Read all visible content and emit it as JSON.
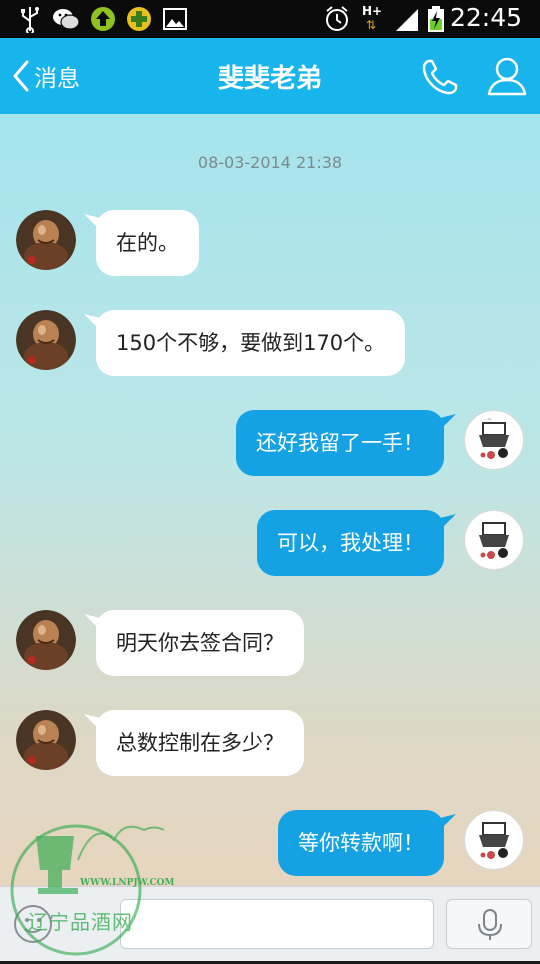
{
  "status_bar": {
    "time": "22:45",
    "network": "H+",
    "icons": [
      "usb-icon",
      "wechat-icon",
      "upload-icon",
      "plus-app-icon",
      "image-icon",
      "alarm-icon",
      "network-hplus-icon",
      "signal-icon",
      "battery-charging-icon"
    ]
  },
  "header": {
    "back_label": "消息",
    "title": "斐斐老弟",
    "accent": "#18b4ec"
  },
  "chat": {
    "timestamp": "08-03-2014 21:38",
    "messages": [
      {
        "side": "in",
        "text": "在的。"
      },
      {
        "side": "in",
        "text": "150个不够，要做到170个。"
      },
      {
        "side": "out",
        "text": "还好我留了一手！"
      },
      {
        "side": "out",
        "text": "可以，我处理！"
      },
      {
        "side": "in",
        "text": "明天你去签合同？"
      },
      {
        "side": "in",
        "text": "总数控制在多少？"
      },
      {
        "side": "out",
        "text": "等你转款啊！"
      }
    ]
  },
  "input": {
    "placeholder": ""
  },
  "watermark": {
    "url": "WWW.LNPJW.COM",
    "text": "辽宁品酒网"
  },
  "colors": {
    "incoming_bubble": "#ffffff",
    "outgoing_bubble": "#14a2e4",
    "watermark": "#2aa84a"
  }
}
